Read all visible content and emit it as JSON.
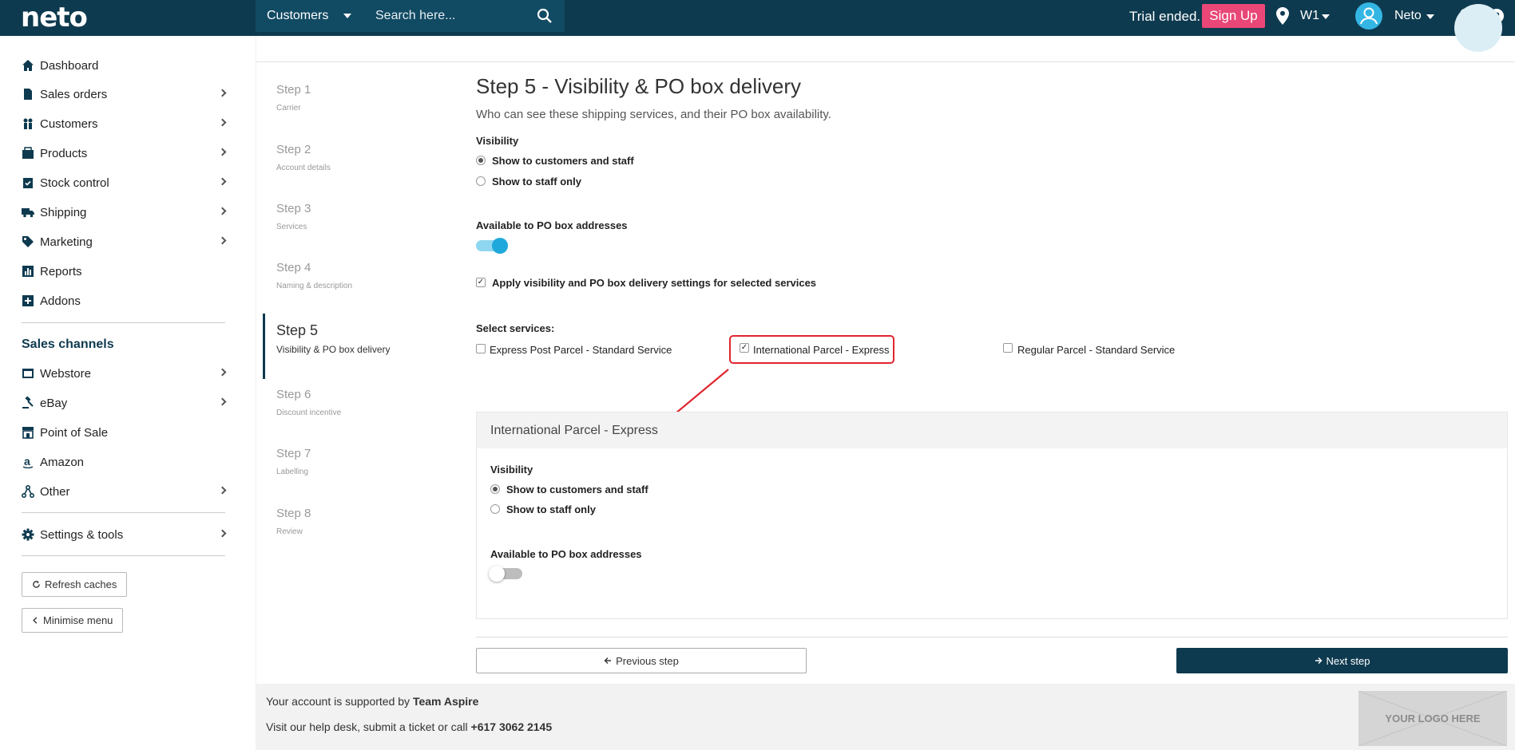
{
  "header": {
    "logo": "neto",
    "search_scope": "Customers",
    "search_placeholder": "Search here...",
    "trial_text": "Trial ended.",
    "signup_label": "Sign Up",
    "location": "W1",
    "user": "Neto"
  },
  "sidebar": {
    "items": [
      {
        "label": "Dashboard",
        "icon": "home-icon"
      },
      {
        "label": "Sales orders",
        "icon": "document-icon"
      },
      {
        "label": "Customers",
        "icon": "users-icon"
      },
      {
        "label": "Products",
        "icon": "products-icon"
      },
      {
        "label": "Stock control",
        "icon": "clipboard-check-icon"
      },
      {
        "label": "Shipping",
        "icon": "truck-icon"
      },
      {
        "label": "Marketing",
        "icon": "tag-icon"
      },
      {
        "label": "Reports",
        "icon": "chart-icon"
      },
      {
        "label": "Addons",
        "icon": "plus-square-icon"
      }
    ],
    "channels_heading": "Sales channels",
    "channels": [
      {
        "label": "Webstore",
        "icon": "webstore-icon"
      },
      {
        "label": "eBay",
        "icon": "gavel-icon"
      },
      {
        "label": "Point of Sale",
        "icon": "storefront-icon"
      },
      {
        "label": "Amazon",
        "icon": "amazon-icon"
      },
      {
        "label": "Other",
        "icon": "share-nodes-icon"
      }
    ],
    "settings": "Settings & tools",
    "refresh": "Refresh caches",
    "minimise": "Minimise menu"
  },
  "steps": [
    {
      "title": "Step 1",
      "sub": "Carrier"
    },
    {
      "title": "Step 2",
      "sub": "Account details"
    },
    {
      "title": "Step 3",
      "sub": "Services"
    },
    {
      "title": "Step 4",
      "sub": "Naming & description"
    },
    {
      "title": "Step 5",
      "sub": "Visibility & PO box delivery"
    },
    {
      "title": "Step 6",
      "sub": "Discount incentive"
    },
    {
      "title": "Step 7",
      "sub": "Labelling"
    },
    {
      "title": "Step 8",
      "sub": "Review"
    }
  ],
  "main": {
    "title": "Step 5 - Visibility & PO box delivery",
    "subtitle": "Who can see these shipping services, and their PO box availability.",
    "visibility_label": "Visibility",
    "vis_option_1": "Show to customers and staff",
    "vis_option_2": "Show to staff only",
    "po_label": "Available to PO box addresses",
    "po_enabled": true,
    "apply_label": "Apply visibility and PO box delivery settings for selected services",
    "select_label": "Select services:",
    "services": [
      {
        "label": "Express Post Parcel - Standard Service",
        "checked": false
      },
      {
        "label": "International Parcel - Express",
        "checked": true
      },
      {
        "label": "Regular Parcel - Standard Service",
        "checked": false
      }
    ]
  },
  "panel": {
    "title": "International Parcel - Express",
    "visibility_label": "Visibility",
    "vis_option_1": "Show to customers and staff",
    "vis_option_2": "Show to staff only",
    "po_label": "Available to PO box addresses",
    "po_enabled": false
  },
  "buttons": {
    "prev": "Previous step",
    "next": "Next step"
  },
  "footer": {
    "support_prefix": "Your account is supported by ",
    "support_team": "Team Aspire",
    "help_prefix": "Visit our help desk, submit a ticket or call ",
    "phone": "+617 3062 2145",
    "logo_placeholder": "YOUR LOGO HERE"
  },
  "colors": {
    "brand": "#0e3a4f",
    "signup": "#e94777",
    "toggle_on": "#1fa8db",
    "highlight": "#e0252f"
  }
}
